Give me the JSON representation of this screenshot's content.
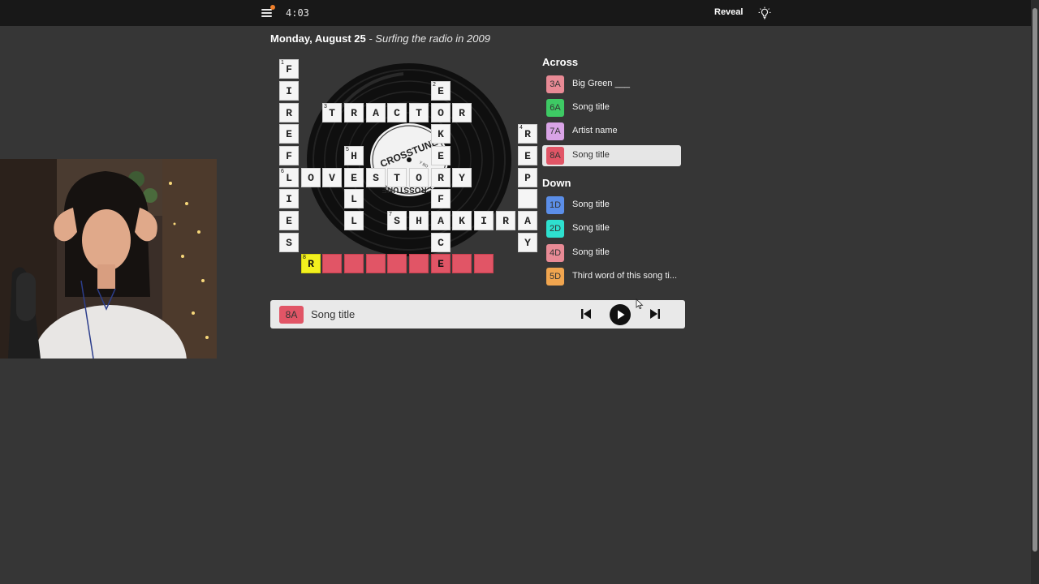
{
  "topbar": {
    "timer": "4:03",
    "reveal_label": "Reveal",
    "menu_icon": "hamburger-menu-icon",
    "hint_icon": "lightbulb-icon",
    "notification_color": "#f07f2a"
  },
  "puzzle": {
    "date": "Monday, August 25",
    "subtitle": " - Surfing the radio in 2009"
  },
  "grid": {
    "numbers": {
      "1": "1",
      "2": "2",
      "3": "3",
      "4": "4",
      "5": "5",
      "6": "6",
      "7": "7",
      "8": "8"
    },
    "fireflies": [
      "F",
      "I",
      "R",
      "E",
      "F",
      "L",
      "I",
      "E",
      "S"
    ],
    "tractor": [
      "T",
      "R",
      "A",
      "C",
      "T",
      "O",
      "R"
    ],
    "love_story": [
      "O",
      "V",
      "E",
      "S",
      "T",
      "O",
      "R",
      "Y"
    ],
    "shakira": [
      "S",
      "H",
      "A",
      "K",
      "I",
      "R",
      "A"
    ],
    "ekeeffe": [
      "E",
      "K",
      "E",
      "F",
      "C"
    ],
    "hell": [
      "H",
      "L",
      "L"
    ],
    "repay": [
      "R",
      "E",
      "P",
      "A",
      "Y"
    ],
    "answer_8a": [
      "R",
      "",
      "",
      "",
      "",
      "",
      "E",
      "",
      ""
    ]
  },
  "vinyl": {
    "label_text": "CROSSTUNE",
    "label_text_bottom": "CROSSTUNE",
    "small_text": "Y BO"
  },
  "clues": {
    "across_heading": "Across",
    "down_heading": "Down",
    "across": [
      {
        "num": "3A",
        "text": "Big Green ___",
        "color": "#e88a95"
      },
      {
        "num": "6A",
        "text": "Song title",
        "color": "#3ec964"
      },
      {
        "num": "7A",
        "text": "Artist name",
        "color": "#d9a3e6"
      },
      {
        "num": "8A",
        "text": "Song title",
        "color": "#e15566",
        "selected": true
      }
    ],
    "down": [
      {
        "num": "1D",
        "text": "Song title",
        "color": "#5b8ee8"
      },
      {
        "num": "2D",
        "text": "Song title",
        "color": "#2ee0cf"
      },
      {
        "num": "4D",
        "text": "Song title",
        "color": "#e88a95"
      },
      {
        "num": "5D",
        "text": "Third word of this song ti...",
        "color": "#f0a54f"
      }
    ]
  },
  "player": {
    "clue_num": "8A",
    "clue_text": "Song title",
    "prev_icon": "skip-previous-icon",
    "play_icon": "play-icon",
    "next_icon": "skip-next-icon"
  },
  "colors": {
    "background": "#363636",
    "topbar": "#181818",
    "active_clue": "#e15566",
    "cursor_cell": "#f2f01e"
  }
}
